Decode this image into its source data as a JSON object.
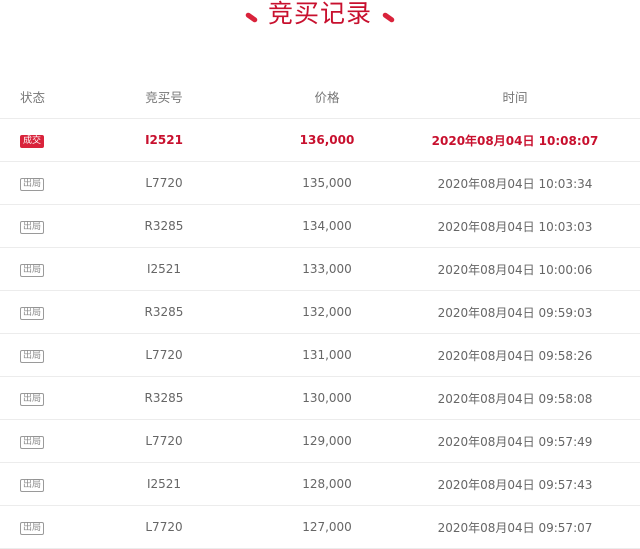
{
  "page_title": "竞买记录",
  "accent_color": "#c8102e",
  "columns": {
    "status": "状态",
    "bid_no": "竞买号",
    "price": "价格",
    "time": "时间"
  },
  "rows": [
    {
      "status": "成交",
      "bid_no": "I2521",
      "price": "136,000",
      "time": "2020年08月04日 10:08:07"
    },
    {
      "status": "出局",
      "bid_no": "L7720",
      "price": "135,000",
      "time": "2020年08月04日 10:03:34"
    },
    {
      "status": "出局",
      "bid_no": "R3285",
      "price": "134,000",
      "time": "2020年08月04日 10:03:03"
    },
    {
      "status": "出局",
      "bid_no": "I2521",
      "price": "133,000",
      "time": "2020年08月04日 10:00:06"
    },
    {
      "status": "出局",
      "bid_no": "R3285",
      "price": "132,000",
      "time": "2020年08月04日 09:59:03"
    },
    {
      "status": "出局",
      "bid_no": "L7720",
      "price": "131,000",
      "time": "2020年08月04日 09:58:26"
    },
    {
      "status": "出局",
      "bid_no": "R3285",
      "price": "130,000",
      "time": "2020年08月04日 09:58:08"
    },
    {
      "status": "出局",
      "bid_no": "L7720",
      "price": "129,000",
      "time": "2020年08月04日 09:57:49"
    },
    {
      "status": "出局",
      "bid_no": "I2521",
      "price": "128,000",
      "time": "2020年08月04日 09:57:43"
    },
    {
      "status": "出局",
      "bid_no": "L7720",
      "price": "127,000",
      "time": "2020年08月04日 09:57:07"
    }
  ]
}
